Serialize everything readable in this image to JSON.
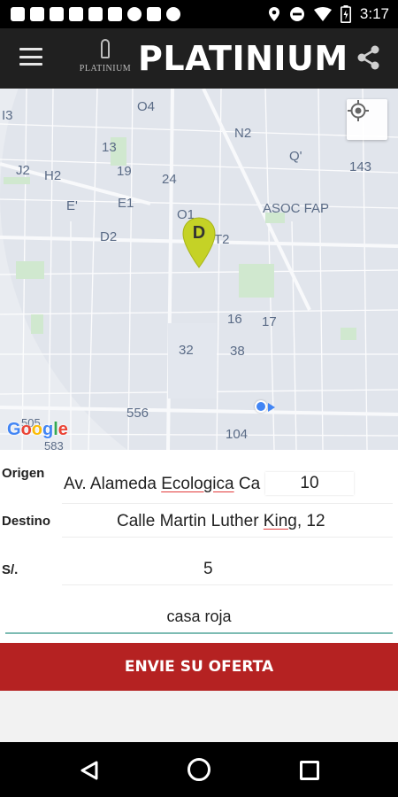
{
  "status_bar": {
    "time": "3:17",
    "icons": [
      "notification-icon",
      "notification-icon",
      "youtube-icon",
      "notification-icon",
      "qr-icon",
      "gmail-icon",
      "notification-icon",
      "notification-icon",
      "notification-icon",
      "location-icon",
      "dnd-icon",
      "wifi-icon",
      "battery-icon"
    ]
  },
  "app_bar": {
    "logo_text": "PLATINIUM",
    "title": "PLATINIUM",
    "menu_icon": "hamburger-menu-icon",
    "share_icon": "share-icon"
  },
  "map": {
    "labels": [
      "I3",
      "O4",
      "N2",
      "143",
      "13",
      "Q'",
      "J2",
      "H2",
      "19",
      "24",
      "E'",
      "E1",
      "O1",
      "ASOC FAP",
      "D2",
      "T2",
      "16",
      "17",
      "32",
      "38",
      "556",
      "505",
      "104",
      "583"
    ],
    "pin_letter": "D",
    "attribution": "Google",
    "locate_icon": "my-location-icon"
  },
  "form": {
    "origen_label": "Origen",
    "origen_value_pre": "Av. Alameda ",
    "origen_value_word": "Ecologica",
    "origen_value_post": " Ca",
    "origen_number": "10",
    "destino_label": "Destino",
    "destino_value_pre": "Calle Martin Luther ",
    "destino_value_word": "King",
    "destino_value_post": ", 12",
    "price_label": "S/.",
    "price_value": "5",
    "reference_value": "casa roja",
    "submit_label": "ENVIE SU OFERTA"
  },
  "colors": {
    "app_bar": "#202020",
    "submit": "#b52222",
    "input_underline": "#7dbcb3",
    "pin": "#c5d226",
    "location_dot": "#4285f4"
  }
}
